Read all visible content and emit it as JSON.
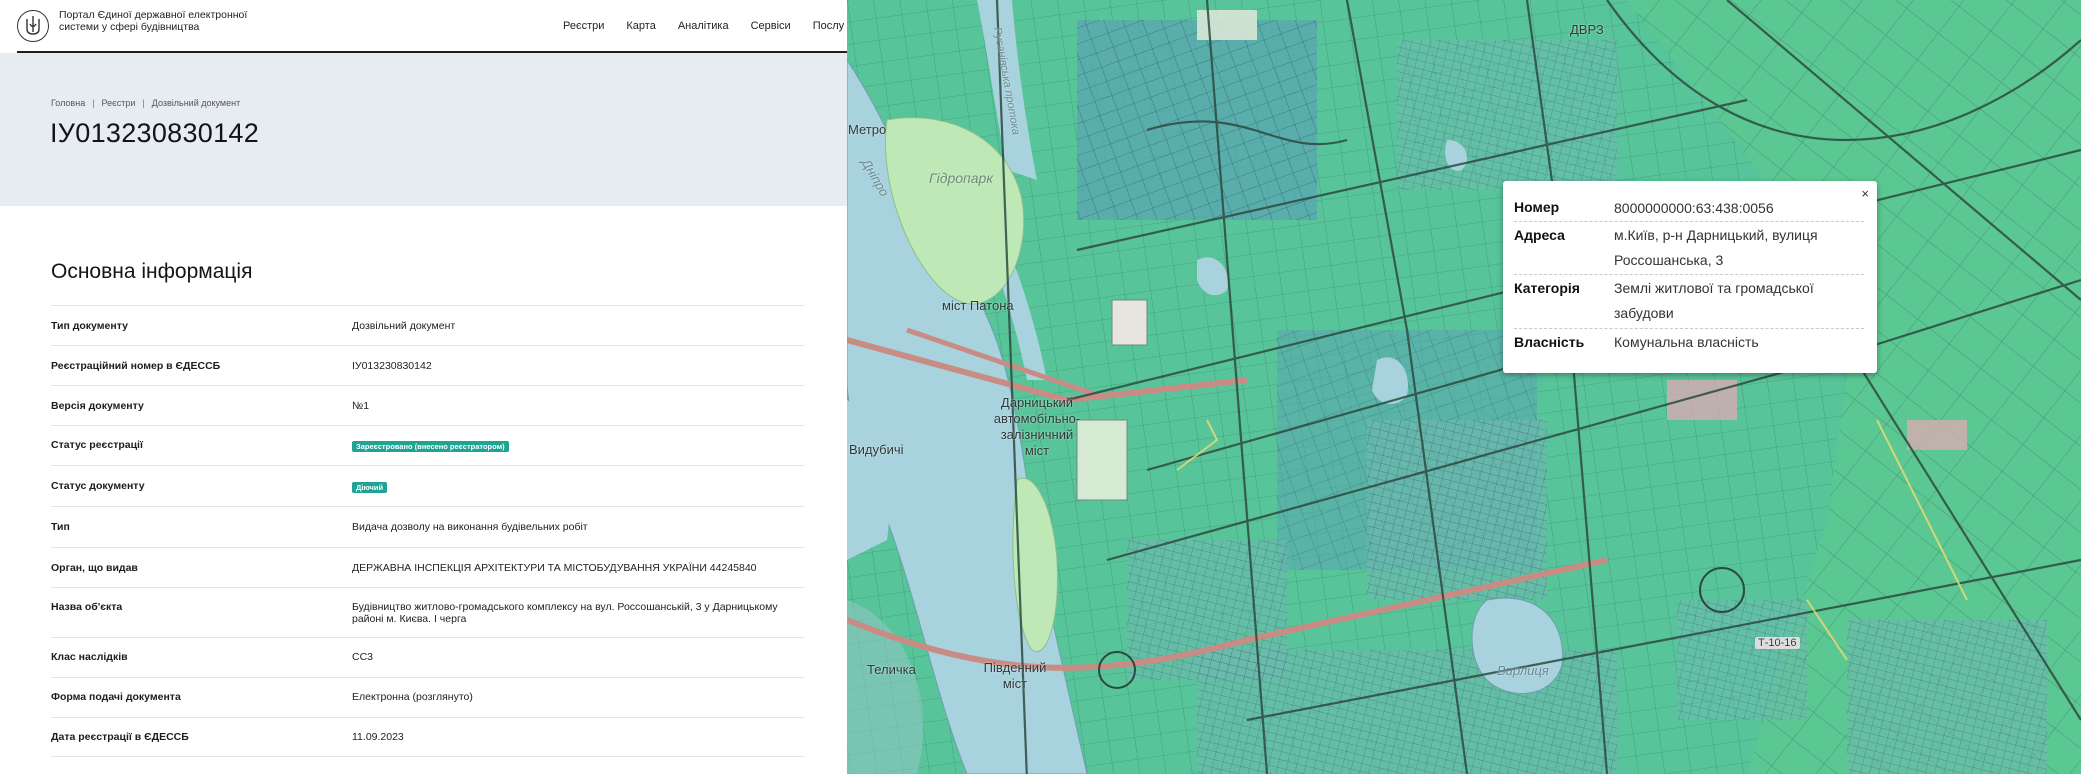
{
  "header": {
    "portal_name": "Портал Єдиної державної електронної системи у сфері будівництва",
    "nav": [
      "Реєстри",
      "Карта",
      "Аналітика",
      "Сервіси",
      "Послу"
    ]
  },
  "breadcrumb": [
    "Головна",
    "Реєстри",
    "Дозвільний документ"
  ],
  "page_title": "ІУ013230830142",
  "section_title": "Основна інформація",
  "info_rows": [
    {
      "label": "Тип документу",
      "value": "Дозвільний документ"
    },
    {
      "label": "Реєстраційний номер в ЄДЕССБ",
      "value": "ІУ013230830142"
    },
    {
      "label": "Версія документу",
      "value": "№1"
    },
    {
      "label": "Статус реєстрації",
      "badge": "Зареєстровано (внесено реєстратором)"
    },
    {
      "label": "Статус документу",
      "badge": "Діючий"
    },
    {
      "label": "Тип",
      "value": "Видача дозволу на виконання будівельних робіт"
    },
    {
      "label": "Орган, що видав",
      "value": "ДЕРЖАВНА ІНСПЕКЦІЯ АРХІТЕКТУРИ ТА МІСТОБУДУВАННЯ УКРАЇНИ 44245840"
    },
    {
      "label": "Назва об'єкта",
      "value": "Будівництво житлово-громадського комплексу на вул. Россошанській, 3 у Дарницькому районі м. Києва. І черга"
    },
    {
      "label": "Клас наслідків",
      "value": "СС3"
    },
    {
      "label": "Форма подачі документа",
      "value": "Електронна (розглянуто)"
    },
    {
      "label": "Дата реєстрації в ЄДЕССБ",
      "value": "11.09.2023"
    }
  ],
  "map": {
    "labels": [
      "Метро",
      "Дніпро",
      "Гідропарк",
      "міст Патона",
      "Дарницький автомобільно-залізничний міст",
      "Видубичі",
      "Південний міст",
      "Теличка",
      "ДВРЗ",
      "Вирлиця",
      "Т-10-16",
      "Русанівська протока"
    ]
  },
  "popup": {
    "close": "×",
    "rows": [
      {
        "key": "Номер",
        "value": "8000000000:63:438:0056"
      },
      {
        "key": "Адреса",
        "value": "м.Київ, р-н Дарницький, вулиця Россошанська, 3"
      },
      {
        "key": "Категорія",
        "value": "Землі житлової та громадської забудови"
      },
      {
        "key": "Власність",
        "value": "Комунальна власність"
      }
    ]
  },
  "colors": {
    "accent": "#1fa392",
    "hero_bg": "#e7ecf3",
    "map_parcel": "#58c79c",
    "map_water": "#a9d3df"
  }
}
